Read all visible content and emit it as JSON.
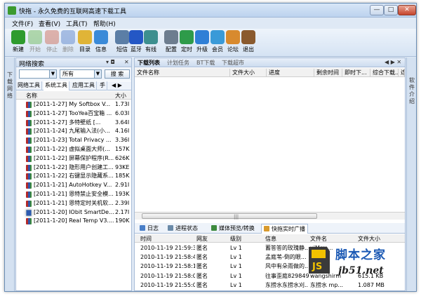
{
  "window": {
    "title": "快拖 - 永久免费的互联网高速下载工具",
    "controls": [
      "—",
      "□",
      "✕"
    ]
  },
  "menu": [
    "文件(F)",
    "查看(V)",
    "工具(T)",
    "帮助(H)"
  ],
  "toolbar": [
    {
      "label": "新建",
      "icon": "plus-icon",
      "enabled": true,
      "color": "#2e9b2e"
    },
    {
      "label": "开始",
      "icon": "play-arrow-icon",
      "enabled": false,
      "color": "#7cbf6b"
    },
    {
      "label": "停止",
      "icon": "stop-icon",
      "enabled": false,
      "color": "#d07b6b"
    },
    {
      "label": "删除",
      "icon": "delete-x-icon",
      "enabled": false,
      "color": "#6b8fd0"
    },
    {
      "label": "目录",
      "icon": "folder-box-icon",
      "enabled": true,
      "color": "#e0b437"
    },
    {
      "label": "信息",
      "icon": "info-people-icon",
      "enabled": true,
      "color": "#3a8ad8"
    },
    {
      "label": "短信",
      "icon": "sms-phone-icon",
      "enabled": true,
      "color": "#5b7ea6"
    },
    {
      "label": "蓝牙",
      "icon": "bluetooth-icon",
      "enabled": true,
      "color": "#2457c5"
    },
    {
      "label": "有线",
      "icon": "cable-icon",
      "enabled": true,
      "color": "#3d8f8f"
    },
    {
      "label": "配置",
      "icon": "gear-icon",
      "enabled": true,
      "color": "#6d7d8f"
    },
    {
      "label": "定时",
      "icon": "timer-icon",
      "enabled": true,
      "color": "#2e9b4a"
    },
    {
      "label": "升级",
      "icon": "upgrade-icon",
      "enabled": true,
      "color": "#2f7fd6"
    },
    {
      "label": "会员",
      "icon": "members-icon",
      "enabled": true,
      "color": "#3a9ad8"
    },
    {
      "label": "论坛",
      "icon": "house-icon",
      "enabled": true,
      "color": "#d88a2e"
    },
    {
      "label": "退出",
      "icon": "exit-door-icon",
      "enabled": true,
      "color": "#8a5a2e"
    }
  ],
  "left_strip_text": "下载网络",
  "right_strip_text": "软件介绍",
  "left_panel": {
    "title": "网络搜索",
    "ctl_pin": "▾ ◘",
    "ctl_close": "✕",
    "search": {
      "type_value": "",
      "scope_value": "所有",
      "button": "搜 索"
    },
    "tabs": [
      "网络工具",
      "系统工具",
      "应用工具",
      "手"
    ],
    "tab_arrows": "◀ ▶",
    "headers": {
      "name": "名称",
      "size": "大小"
    },
    "files": [
      {
        "name": "[2011-1-27] My Softbox V...",
        "size": "1.73I"
      },
      {
        "name": "[2011-1-27] TooYea百宝箱 ...",
        "size": "6.03I"
      },
      {
        "name": "[2011-1-27] 多特壁纸      [...",
        "size": "3.64I"
      },
      {
        "name": "[2011-1-24] 九尾输入法(小...",
        "size": "4.16I"
      },
      {
        "name": "[2011-1-23] Total Privacy ...",
        "size": "3.36I"
      },
      {
        "name": "[2011-1-22] 虚拟桌面大师(...",
        "size": "157K"
      },
      {
        "name": "[2011-1-22] 屏幕保护程序(R...",
        "size": "626K"
      },
      {
        "name": "[2011-1-22] 隐形用户创建工...",
        "size": "93KE"
      },
      {
        "name": "[2011-1-22] 右键显示隐藏系...",
        "size": "185K"
      },
      {
        "name": "[2011-1-21] AutoHotkey V...",
        "size": "2.91I"
      },
      {
        "name": "[2011-1-21] 恩特禁止安全模...",
        "size": "193K"
      },
      {
        "name": "[2011-1-21] 恩特定时关机软...",
        "size": "2.39I"
      },
      {
        "name": "[2011-1-20] IObit SmartDe...",
        "size": "2.17I"
      },
      {
        "name": "[2011-1-20] Real Temp V3....",
        "size": "190K"
      }
    ]
  },
  "main": {
    "tabs": [
      "下载列表",
      "计划任务",
      "BT下载",
      "下载超市"
    ],
    "tab_ctl": "◀ ▶ ✕",
    "columns": [
      "文件名称",
      "文件大小",
      "进度",
      "剩余时间",
      "即时下...",
      "综合下载...",
      "连"
    ],
    "scroll_grip": "|||",
    "bottom_tabs": [
      {
        "label": "日志",
        "color": "#4a7fc8"
      },
      {
        "label": "进程状态",
        "color": "#6a8aa8"
      },
      {
        "label": "媒体预览/转换",
        "color": "#3d8a3d"
      },
      {
        "label": "快拖实时广播",
        "color": "#d89a2e"
      }
    ],
    "log_headers": [
      "时间",
      "网友",
      "级别",
      "信息",
      "文件名",
      "文件大小"
    ],
    "log_rows": [
      [
        "2010-11-19 21:59:34",
        "匿名",
        "Lv 1",
        "蓄答答的玫瑰静...",
        "xiMrm...",
        ""
      ],
      [
        "2010-11-19 21:58:45",
        "匿名",
        "Lv 1",
        "孟庭苇-倒的眼...",
        "",
        ""
      ],
      [
        "2010-11-19 21:58:16",
        "匿名",
        "Lv 1",
        "风中有朵雨做的...",
        "",
        ""
      ],
      [
        "2010-11-19 21:58:08",
        "匿名",
        "Lv 1",
        "往事歪庭829849...",
        "wangshirm",
        "615.1 KB"
      ],
      [
        "2010-11-19 21:55:07",
        "匿名",
        "Lv 1",
        "东捞水东捞水刈...",
        "东捞水 mp...",
        "1.087 MB"
      ]
    ]
  },
  "watermark": {
    "name": "脚本之家",
    "url": "jb51.net",
    "logo_letters": "JS"
  }
}
